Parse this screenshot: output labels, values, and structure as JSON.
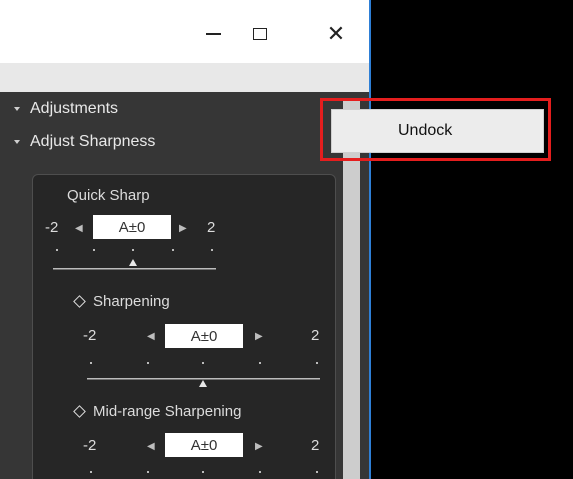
{
  "window": {
    "controls": {
      "minimize": "—",
      "maximize": "□",
      "close": "✕"
    }
  },
  "sidebar": {
    "sections": [
      {
        "label": "Adjustments",
        "icon": "chevron-down-icon"
      },
      {
        "label": "Adjust Sharpness",
        "icon": "chevron-down-icon"
      }
    ]
  },
  "quick_sharp": {
    "title": "Quick Sharp",
    "min": "-2",
    "max": "2",
    "value": "A±0"
  },
  "sharpening": {
    "title": "Sharpening",
    "min": "-2",
    "max": "2",
    "value": "A±0"
  },
  "midrange": {
    "title": "Mid-range Sharpening",
    "min": "-2",
    "max": "2",
    "value": "A±0"
  },
  "context_menu": {
    "items": [
      {
        "label": "Undock"
      }
    ]
  },
  "colors": {
    "highlight": "#e51e1e",
    "window_border": "#2e7fd6",
    "panel_bg": "#363636"
  }
}
